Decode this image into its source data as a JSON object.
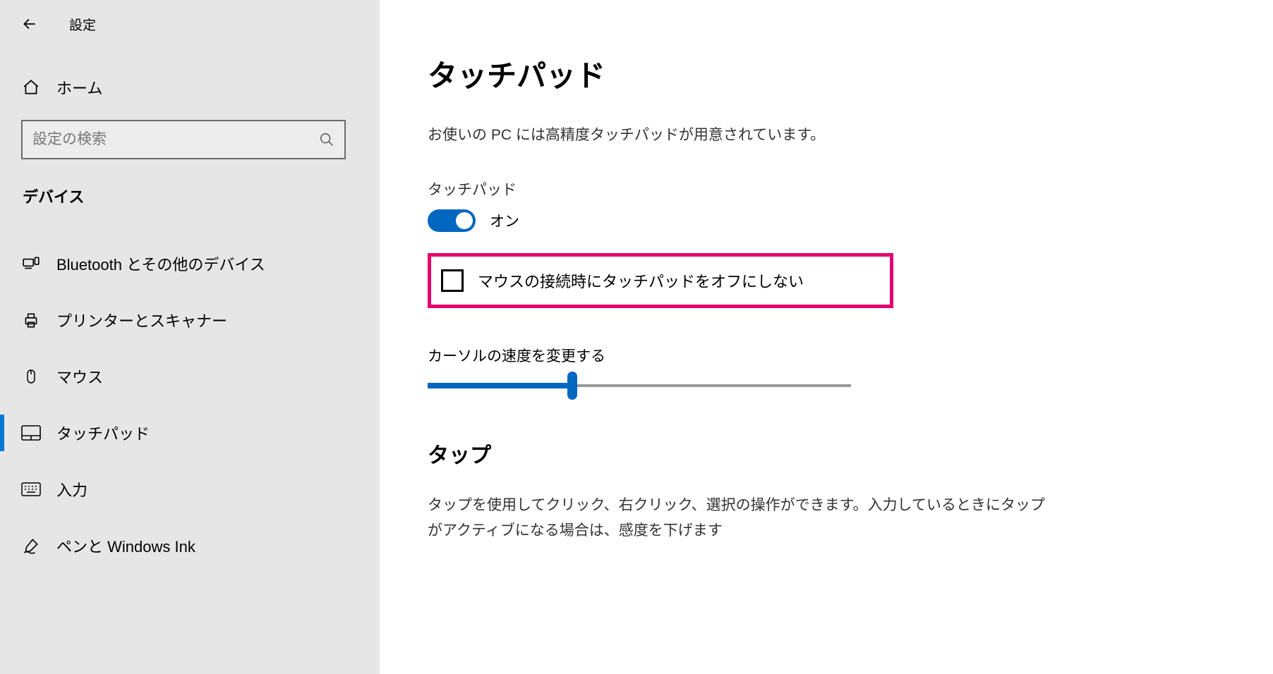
{
  "header": {
    "title": "設定"
  },
  "sidebar": {
    "home": "ホーム",
    "search_placeholder": "設定の検索",
    "section": "デバイス",
    "items": [
      {
        "label": "Bluetooth とその他のデバイス"
      },
      {
        "label": "プリンターとスキャナー"
      },
      {
        "label": "マウス"
      },
      {
        "label": "タッチパッド"
      },
      {
        "label": "入力"
      },
      {
        "label": "ペンと Windows Ink"
      }
    ]
  },
  "main": {
    "title": "タッチパッド",
    "description": "お使いの PC には高精度タッチパッドが用意されています。",
    "toggle_label": "タッチパッド",
    "toggle_state": "オン",
    "checkbox_label": "マウスの接続時にタッチパッドをオフにしない",
    "slider_label": "カーソルの速度を変更する",
    "tap_title": "タップ",
    "tap_desc": "タップを使用してクリック、右クリック、選択の操作ができます。入力しているときにタップがアクティブになる場合は、感度を下げます"
  }
}
